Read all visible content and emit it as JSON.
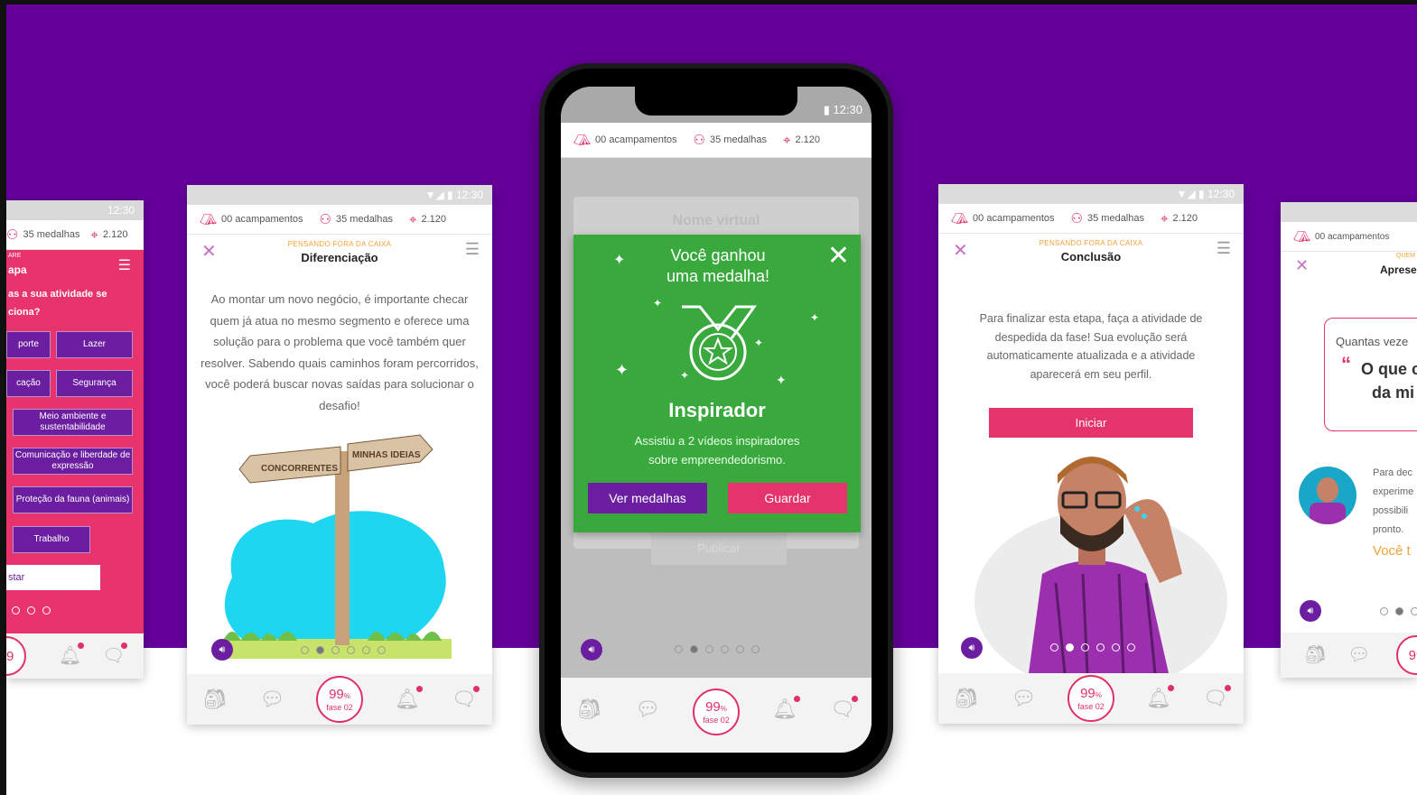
{
  "status": {
    "time": "12:30"
  },
  "topbar": {
    "camps": "00 acampamentos",
    "medals": "35 medalhas",
    "points": "2.120"
  },
  "progress": {
    "percent": "99",
    "unit": "%",
    "phase": "fase 02"
  },
  "icons": {
    "camp": "tent-icon",
    "medal": "medal-icon",
    "points": "location-pin-icon",
    "backpack": "backpack-icon",
    "chat": "chat-icon",
    "bell": "bell-icon",
    "message": "message-icon",
    "sound": "sound-icon",
    "close": "close-icon",
    "menu": "menu-icon"
  },
  "colors": {
    "purple": "#65009a",
    "pink": "#e5336b",
    "green": "#3aa93d",
    "orange": "#f2a23a"
  },
  "screen1": {
    "kicker": "ARE",
    "title": "apa",
    "question1": "as a sua atividade se",
    "question2": "ciona?",
    "options": [
      "porte",
      "Lazer",
      "cação",
      "Segurança",
      "Meio ambiente e sustentabilidade",
      "Comunicação e liberdade de expressão",
      "Proteção da fauna (animais)",
      "Trabalho"
    ],
    "input_label": "star"
  },
  "screen2": {
    "kicker": "PENSANDO FORA DA CAIXA",
    "title": "Diferenciação",
    "text": "Ao montar um novo negócio, é importante checar quem já atua no mesmo segmento e oferece uma solução para o problema que você também quer resolver. Sabendo quais caminhos foram percorridos, você poderá buscar novas saídas para solucionar o desafio!",
    "sign_left": "CONCORRENTES",
    "sign_right": "MINHAS IDEIAS"
  },
  "screen3": {
    "behind_label": "Nome virtual",
    "behind_button": "Publicar",
    "modal": {
      "title": "Você ganhou uma medalha!",
      "badge_name": "Inspirador",
      "description": "Assistiu a 2 vídeos inspiradores sobre empreendedorismo.",
      "btn_medals": "Ver medalhas",
      "btn_save": "Guardar"
    }
  },
  "screen4": {
    "kicker": "PENSANDO FORA DA CAIXA",
    "title": "Conclusão",
    "text": "Para finalizar esta etapa, faça a atividade de despedida da fase! Sua evolução será automaticamente atualizada e a atividade aparecerá em seu perfil.",
    "button": "Iniciar"
  },
  "screen5": {
    "kicker": "QUEM",
    "title": "Aprese",
    "bubble_line1": "Quantas veze",
    "bubble_quote1": "O que c",
    "bubble_quote2": "da mi",
    "body_lines": [
      "Para dec",
      "experime",
      "possibili",
      "pronto."
    ],
    "highlight": "Você t"
  }
}
